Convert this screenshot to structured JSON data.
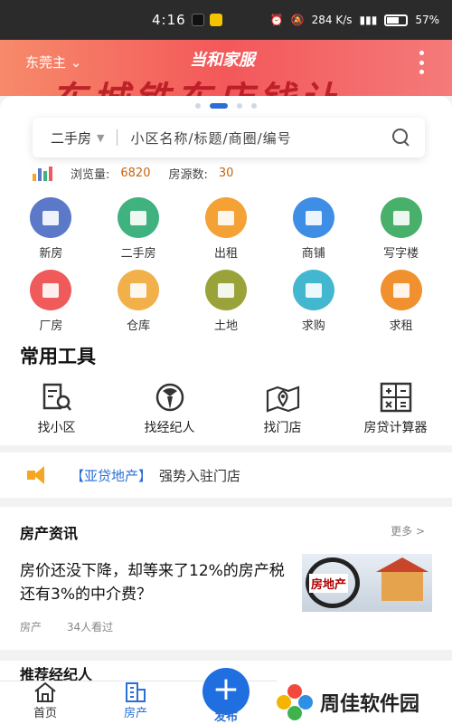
{
  "status_bar": {
    "time": "4:16",
    "network_speed": "284 K/s",
    "battery": "57%"
  },
  "banner": {
    "city": "东莞主",
    "slogan": "当和家服",
    "big_text": "东城铁东店钱让"
  },
  "search": {
    "type": "二手房",
    "placeholder": "小区名称/标题/商圈/编号"
  },
  "stats": {
    "views_label": "浏览量:",
    "views": "6820",
    "listings_label": "房源数:",
    "listings": "30"
  },
  "categories": [
    {
      "label": "新房",
      "color": "#5b78c9"
    },
    {
      "label": "二手房",
      "color": "#3fb27f"
    },
    {
      "label": "出租",
      "color": "#f4a236"
    },
    {
      "label": "商铺",
      "color": "#3e8ee6"
    },
    {
      "label": "写字楼",
      "color": "#48b06a"
    },
    {
      "label": "厂房",
      "color": "#ef5a5a"
    },
    {
      "label": "仓库",
      "color": "#f2b04a"
    },
    {
      "label": "土地",
      "color": "#9aa33a"
    },
    {
      "label": "求购",
      "color": "#43b7cf"
    },
    {
      "label": "求租",
      "color": "#f0902e"
    }
  ],
  "tools": {
    "title": "常用工具",
    "items": [
      {
        "label": "找小区",
        "icon": "building-search-icon"
      },
      {
        "label": "找经纪人",
        "icon": "agent-icon"
      },
      {
        "label": "找门店",
        "icon": "map-pin-icon"
      },
      {
        "label": "房贷计算器",
        "icon": "calculator-icon"
      }
    ]
  },
  "notice": {
    "brand": "【亚贷地产】",
    "message": "强势入驻门店"
  },
  "news": {
    "heading": "房产资讯",
    "more": "更多 >",
    "title": "房价还没下降，却等来了12%的房产税还有3%的中介费？",
    "thumb_tag": "房地产",
    "category": "房产",
    "readers": "34人看过"
  },
  "next_section": "推荐经纪人",
  "tabbar": {
    "home": "首页",
    "property": "房产",
    "publish": "发布"
  },
  "watermark": {
    "text": "周佳软件园"
  }
}
